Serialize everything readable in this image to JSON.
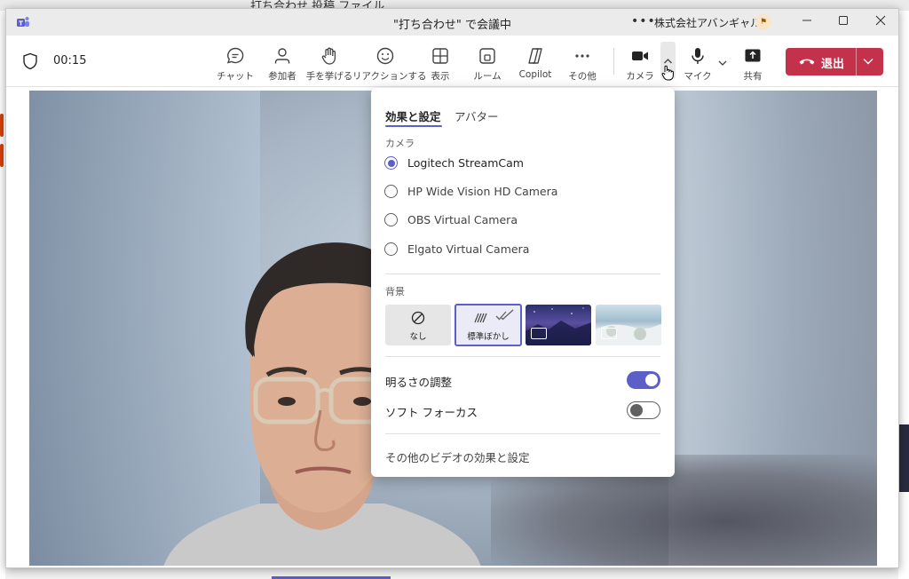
{
  "window": {
    "title": "\"打ち合わせ\" で会議中",
    "org_name": "株式会社アバンギャルド",
    "org_badge": "⚑"
  },
  "background_app": {
    "tab_text": "打ち合わせ  投稿  ファイル"
  },
  "toolbar": {
    "timer": "00:15",
    "buttons": [
      {
        "label": "チャット",
        "icon": "chat-icon"
      },
      {
        "label": "参加者",
        "icon": "people-icon"
      },
      {
        "label": "手を挙げる",
        "icon": "raise-hand-icon"
      },
      {
        "label": "リアクションする",
        "icon": "emoji-icon"
      },
      {
        "label": "表示",
        "icon": "view-grid-icon"
      },
      {
        "label": "ルーム",
        "icon": "rooms-icon"
      },
      {
        "label": "Copilot",
        "icon": "copilot-icon"
      },
      {
        "label": "その他",
        "icon": "more-icon"
      },
      {
        "label": "カメラ",
        "icon": "camera-icon"
      },
      {
        "label": "マイク",
        "icon": "mic-icon"
      },
      {
        "label": "共有",
        "icon": "share-icon"
      }
    ],
    "leave_label": "退出"
  },
  "popup": {
    "tabs": [
      "効果と設定",
      "アバター"
    ],
    "camera_section": "カメラ",
    "cameras": [
      {
        "label": "Logitech StreamCam",
        "selected": true
      },
      {
        "label": "HP Wide Vision HD Camera",
        "selected": false
      },
      {
        "label": "OBS Virtual Camera",
        "selected": false
      },
      {
        "label": "Elgato Virtual Camera",
        "selected": false
      }
    ],
    "background_section": "背景",
    "backgrounds": [
      {
        "label": "なし",
        "icon": "none-icon"
      },
      {
        "label": "標準ぼかし",
        "icon": "blur-icon",
        "selected": true
      },
      {
        "label": "",
        "icon": "video-background-icon"
      },
      {
        "label": "",
        "icon": "video-background-icon"
      }
    ],
    "toggles": [
      {
        "label": "明るさの調整",
        "on": true
      },
      {
        "label": "ソフト フォーカス",
        "on": false
      }
    ],
    "more_link": "その他のビデオの効果と設定"
  },
  "colors": {
    "accent": "#5b5fc7",
    "leave": "#c4314b"
  }
}
